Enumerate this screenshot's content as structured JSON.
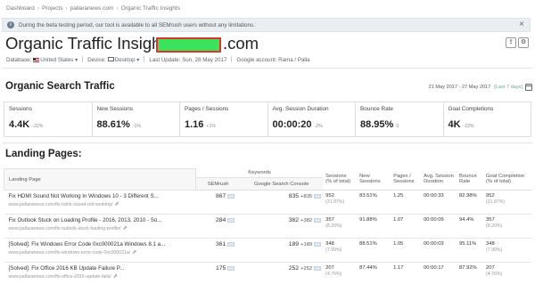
{
  "breadcrumb": [
    "Dashboard",
    "Projects",
    "pallaranews.com",
    "Organic Traffic Insights"
  ],
  "banner": {
    "message": "During the beta testing period, our tool is available to all SEMrush users without any limitations.",
    "info_icon": "info-icon",
    "close_icon": "close-icon"
  },
  "header": {
    "title": "Organic Traffic Insights: p",
    "title_domain_end": ".com",
    "redaction_color": "#3be35a",
    "redaction_border": "#d9352b"
  },
  "meta": {
    "database_label": "Database:",
    "database_value": "United States",
    "device_label": "Device:",
    "device_value": "Desktop",
    "last_update": "Last Update: Sun, 28 May 2017",
    "google_account": "Google account: Rama / Palla"
  },
  "organic": {
    "title": "Organic Search Traffic",
    "daterange": "21 May 2017 - 27 May 2017",
    "daterange_preset": "[Last 7 days]",
    "kpis": [
      {
        "label": "Sessions",
        "value": "4.4K",
        "change": "-22%"
      },
      {
        "label": "New Sessions",
        "value": "88.61%",
        "change": "-1%"
      },
      {
        "label": "Pages / Sessions",
        "value": "1.16",
        "change": "+1%"
      },
      {
        "label": "Avg. Session Duration",
        "value": "00:00:20",
        "change": "-2%"
      },
      {
        "label": "Bounce Rate",
        "value": "88.95%",
        "change": "0"
      },
      {
        "label": "Goal Completions",
        "value": "4K",
        "change": "-22%"
      }
    ]
  },
  "landing": {
    "title": "Landing Pages:",
    "col_landing": "Landing Page",
    "col_keywords": "Keywords",
    "col_semrush": "SEMrush",
    "col_gsc": "Google Search Console",
    "col_sessions": "Sessions\n(% of total)",
    "col_new": "New\nSessions",
    "col_pages": "Pages /\nSessions",
    "col_avg": "Avg. Session\nDuration",
    "col_bounce": "Bounce\nRate",
    "col_goal": "Goal Completion\n(% of total)",
    "rows": [
      {
        "title": "Fix HDMI Sound Not Working In Windows 10 - 3 Different S...",
        "url": "www.pallaranews.com/fix-hdmi-sound-not-working/",
        "semrush": "867",
        "gsc": "835",
        "gsc_delta": "+835",
        "sessions": "952",
        "sessions_pct": "(21.87%)",
        "new": "83.51%",
        "pages": "1.25",
        "avg": "00:00:33",
        "bounce": "82.98%",
        "goal": "952",
        "goal_pct": "(21.87%)"
      },
      {
        "title": "Fix Outlook Stuck on Loading Profile - 2016, 2013, 2010 - So...",
        "url": "www.pallaranews.com/fix-outlook-stuck-loading-profile/",
        "semrush": "284",
        "gsc": "382",
        "gsc_delta": "+382",
        "sessions": "357",
        "sessions_pct": "(8.20%)",
        "new": "91.88%",
        "pages": "1.07",
        "avg": "00:00:09",
        "bounce": "94.4%",
        "goal": "357",
        "goal_pct": "(8.20%)"
      },
      {
        "title": "[Solved]: Fix Windows Error Code 0xc000021a Windows 8.1 a...",
        "url": "www.pallaranews.com/fix-windows-error-code-0xc000021a/",
        "semrush": "361",
        "gsc": "189",
        "gsc_delta": "+189",
        "sessions": "348",
        "sessions_pct": "(7.99%)",
        "new": "88.51%",
        "pages": "1.05",
        "avg": "00:00:03",
        "bounce": "95.11%",
        "goal": "348",
        "goal_pct": "(7.99%)"
      },
      {
        "title": "[Solved]: Fix Office 2016 KB Update Failure P...",
        "url": "www.pallaranews.com/fix-office-2016-update-fails/",
        "semrush": "175",
        "gsc": "252",
        "gsc_delta": "+252",
        "sessions": "207",
        "sessions_pct": "(4.76%)",
        "new": "87.44%",
        "pages": "1.17",
        "avg": "00:00:17",
        "bounce": "87.92%",
        "goal": "207",
        "goal_pct": "(4.76%)"
      }
    ]
  }
}
